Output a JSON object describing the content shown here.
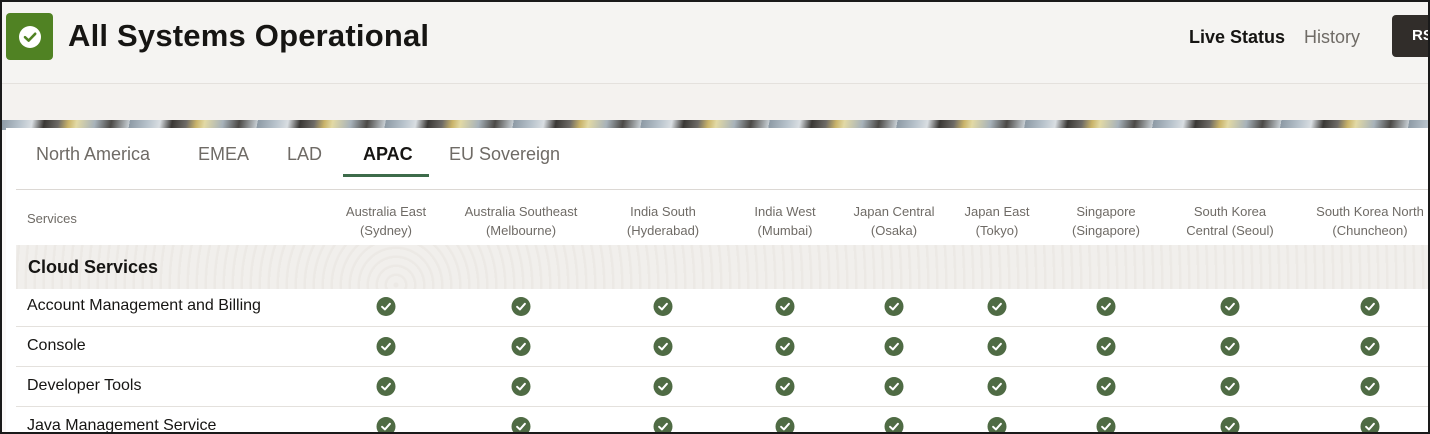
{
  "header": {
    "title": "All Systems Operational",
    "nav": {
      "live_status": "Live Status",
      "history": "History"
    },
    "rss_label": "RSS",
    "status_icon": "check-circle-icon",
    "status_color": "#508223"
  },
  "tabs": [
    {
      "label": "North America",
      "active": false
    },
    {
      "label": "EMEA",
      "active": false
    },
    {
      "label": "LAD",
      "active": false
    },
    {
      "label": "APAC",
      "active": true
    },
    {
      "label": "EU Sovereign",
      "active": false
    }
  ],
  "table": {
    "services_header": "Services",
    "columns": [
      {
        "line1": "Australia East",
        "line2": "(Sydney)"
      },
      {
        "line1": "Australia Southeast",
        "line2": "(Melbourne)"
      },
      {
        "line1": "India South",
        "line2": "(Hyderabad)"
      },
      {
        "line1": "India West",
        "line2": "(Mumbai)"
      },
      {
        "line1": "Japan Central",
        "line2": "(Osaka)"
      },
      {
        "line1": "Japan East",
        "line2": "(Tokyo)"
      },
      {
        "line1": "Singapore",
        "line2": "(Singapore)"
      },
      {
        "line1": "South Korea",
        "line2": "Central (Seoul)"
      },
      {
        "line1": "South Korea North",
        "line2": "(Chuncheon)"
      }
    ],
    "section_title": "Cloud Services",
    "rows": [
      {
        "name": "Account Management and Billing",
        "status": "operational"
      },
      {
        "name": "Console",
        "status": "operational"
      },
      {
        "name": "Developer Tools",
        "status": "operational"
      },
      {
        "name": "Java Management Service",
        "status": "operational"
      }
    ],
    "check_color": "#4f6b44"
  }
}
